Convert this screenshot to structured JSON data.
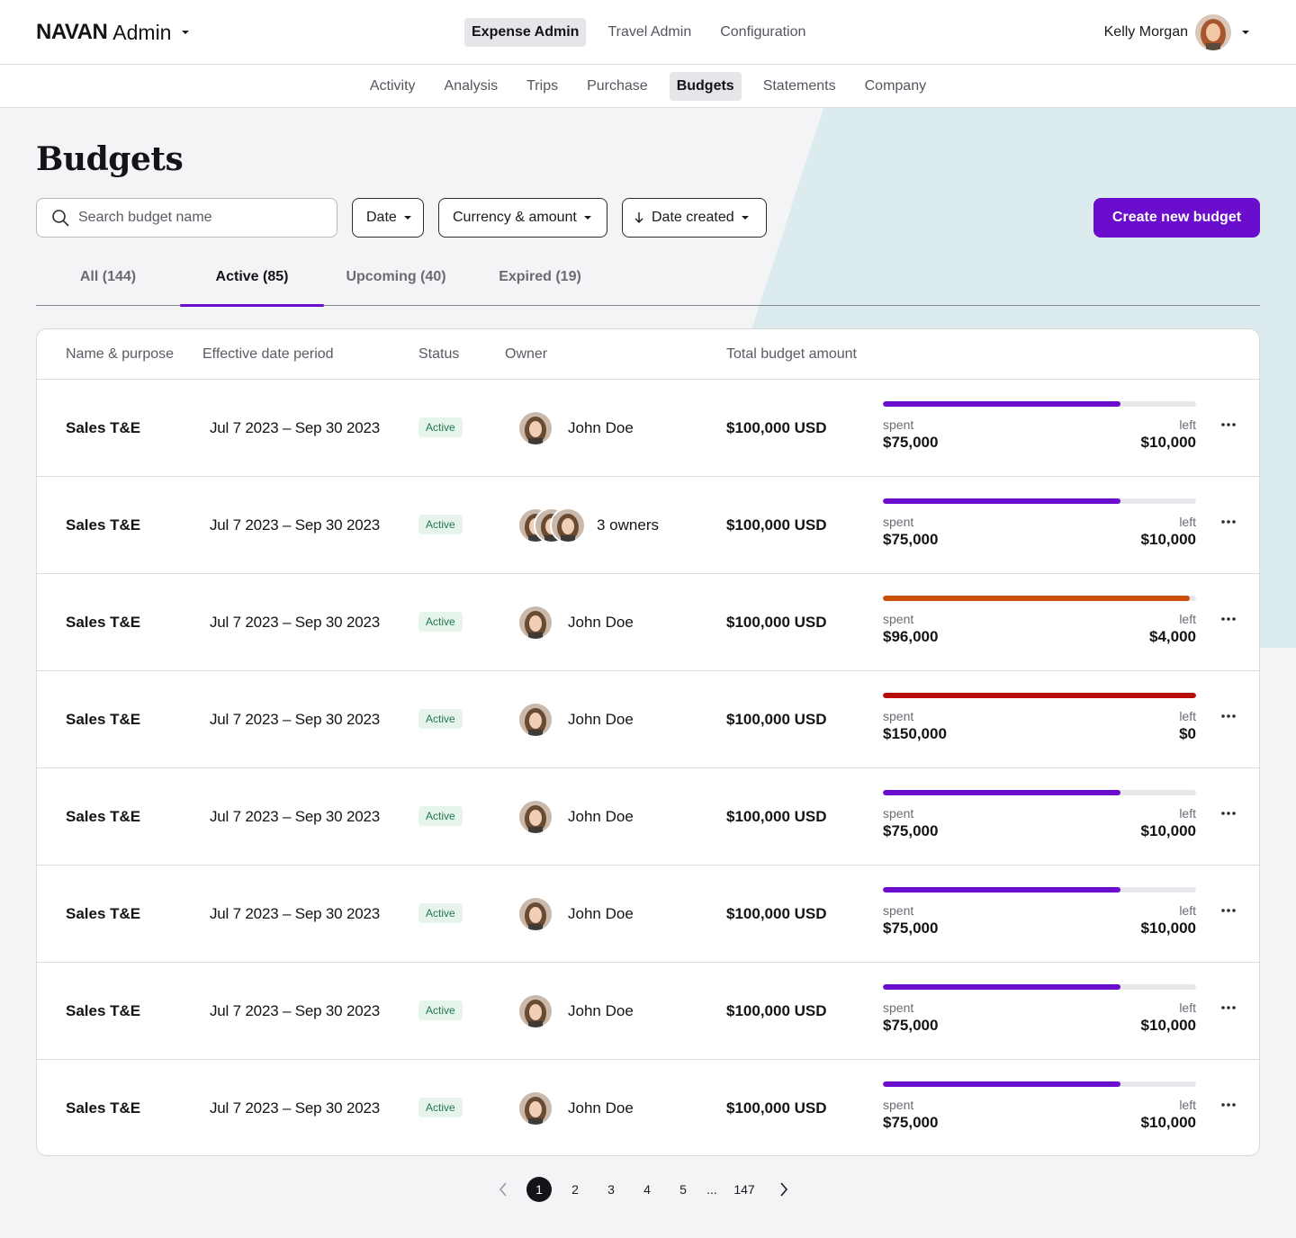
{
  "app": {
    "brand": "NAVAN",
    "brand_suffix": "Admin"
  },
  "top_nav": [
    {
      "label": "Expense Admin",
      "active": true
    },
    {
      "label": "Travel Admin",
      "active": false
    },
    {
      "label": "Configuration",
      "active": false
    }
  ],
  "user": {
    "name": "Kelly Morgan"
  },
  "sub_nav": [
    {
      "label": "Activity",
      "active": false
    },
    {
      "label": "Analysis",
      "active": false
    },
    {
      "label": "Trips",
      "active": false
    },
    {
      "label": "Purchase",
      "active": false
    },
    {
      "label": "Budgets",
      "active": true
    },
    {
      "label": "Statements",
      "active": false
    },
    {
      "label": "Company",
      "active": false
    }
  ],
  "page": {
    "title": "Budgets",
    "search_placeholder": "Search budget name",
    "search_value": "",
    "filters": {
      "date": "Date",
      "currency": "Currency & amount",
      "sort": "Date created"
    },
    "create_button": "Create new budget"
  },
  "tabs": [
    {
      "label": "All (144)",
      "active": false
    },
    {
      "label": "Active (85)",
      "active": true
    },
    {
      "label": "Upcoming (40)",
      "active": false
    },
    {
      "label": "Expired (19)",
      "active": false
    }
  ],
  "table": {
    "headers": {
      "name": "Name & purpose",
      "date": "Effective date period",
      "status": "Status",
      "owner": "Owner",
      "amount": "Total budget amount"
    },
    "spent_label": "spent",
    "left_label": "left",
    "colors": {
      "normal": "#6a0dcc",
      "warning": "#c8500a",
      "over": "#b80c0c"
    },
    "rows": [
      {
        "name": "Sales T&E",
        "date": "Jul 7 2023 – Sep 30 2023",
        "status": "Active",
        "owner": "John Doe",
        "owners": 1,
        "amount": "$100,000 USD",
        "spent": "$75,000",
        "left": "$10,000",
        "progress": 0.76,
        "state": "normal"
      },
      {
        "name": "Sales T&E",
        "date": "Jul 7 2023 – Sep 30 2023",
        "status": "Active",
        "owner": "3 owners",
        "owners": 3,
        "amount": "$100,000 USD",
        "spent": "$75,000",
        "left": "$10,000",
        "progress": 0.76,
        "state": "normal"
      },
      {
        "name": "Sales T&E",
        "date": "Jul 7 2023 – Sep 30 2023",
        "status": "Active",
        "owner": "John Doe",
        "owners": 1,
        "amount": "$100,000 USD",
        "spent": "$96,000",
        "left": "$4,000",
        "progress": 0.98,
        "state": "warning"
      },
      {
        "name": "Sales T&E",
        "date": "Jul 7 2023 – Sep 30 2023",
        "status": "Active",
        "owner": "John Doe",
        "owners": 1,
        "amount": "$100,000 USD",
        "spent": "$150,000",
        "left": "$0",
        "progress": 1.0,
        "state": "over"
      },
      {
        "name": "Sales T&E",
        "date": "Jul 7 2023 – Sep 30 2023",
        "status": "Active",
        "owner": "John Doe",
        "owners": 1,
        "amount": "$100,000 USD",
        "spent": "$75,000",
        "left": "$10,000",
        "progress": 0.76,
        "state": "normal"
      },
      {
        "name": "Sales T&E",
        "date": "Jul 7 2023 – Sep 30 2023",
        "status": "Active",
        "owner": "John Doe",
        "owners": 1,
        "amount": "$100,000 USD",
        "spent": "$75,000",
        "left": "$10,000",
        "progress": 0.76,
        "state": "normal"
      },
      {
        "name": "Sales T&E",
        "date": "Jul 7 2023 – Sep 30 2023",
        "status": "Active",
        "owner": "John Doe",
        "owners": 1,
        "amount": "$100,000 USD",
        "spent": "$75,000",
        "left": "$10,000",
        "progress": 0.76,
        "state": "normal"
      },
      {
        "name": "Sales T&E",
        "date": "Jul 7 2023 – Sep 30 2023",
        "status": "Active",
        "owner": "John Doe",
        "owners": 1,
        "amount": "$100,000 USD",
        "spent": "$75,000",
        "left": "$10,000",
        "progress": 0.76,
        "state": "normal"
      }
    ]
  },
  "pagination": {
    "pages": [
      "1",
      "2",
      "3",
      "4",
      "5"
    ],
    "ellipsis": "...",
    "last": "147",
    "current": "1"
  }
}
